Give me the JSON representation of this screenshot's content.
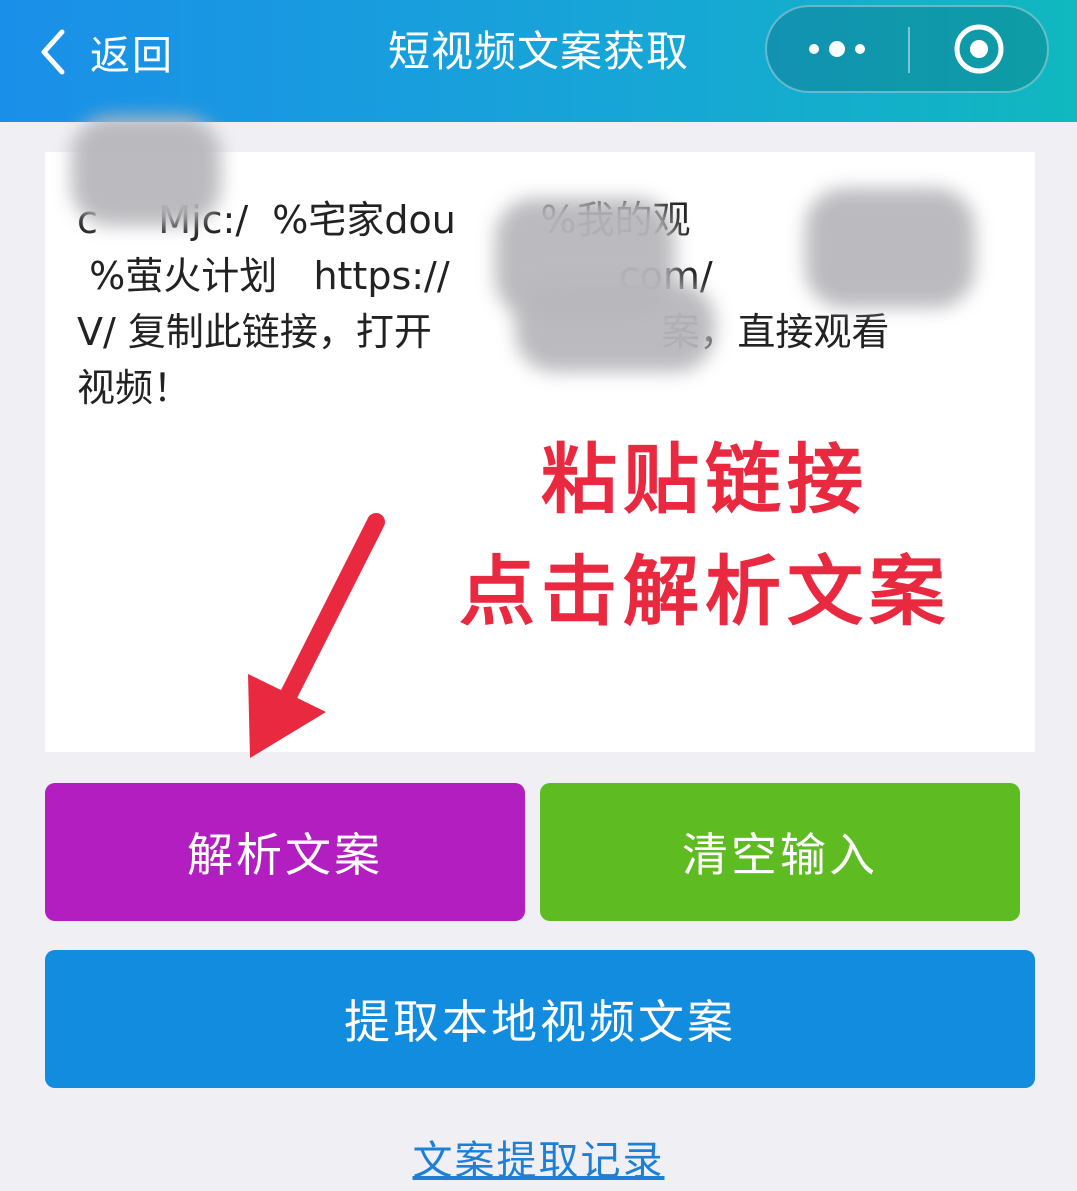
{
  "navbar": {
    "back_label": "返回",
    "title": "短视频文案获取",
    "menu_icon": "more-dots-icon",
    "close_icon": "capsule-close-icon"
  },
  "input": {
    "pasted_text": "c     Mjc:/  %宅家dou       %我的观              \n %萤火计划   https://              com/          \nV/ 复制此链接，打开                   案，直接观看\n视频！"
  },
  "annotation": {
    "line1": "粘贴链接",
    "line2": "点击解析文案",
    "color": "#e8293f"
  },
  "buttons": {
    "parse": "解析文案",
    "clear": "清空输入",
    "extract_local": "提取本地视频文案"
  },
  "history_link": "文案提取记录",
  "colors": {
    "parse_button": "#b31ec0",
    "clear_button": "#5fbb22",
    "extract_button": "#128cdf",
    "link": "#1e7fd6"
  }
}
